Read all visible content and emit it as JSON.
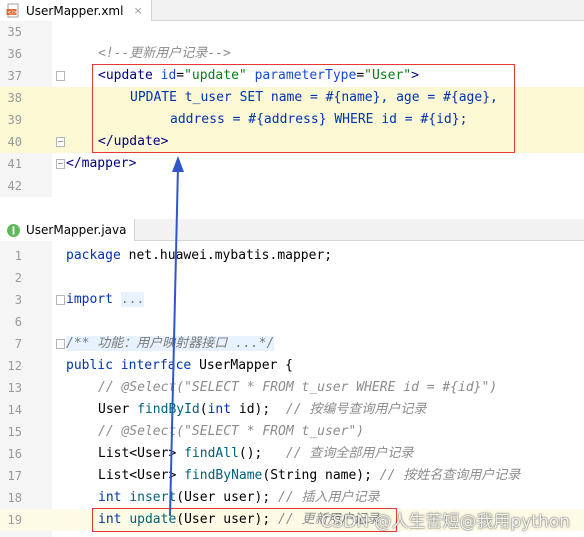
{
  "xml_tab": {
    "filename": "UserMapper.xml",
    "close": "×"
  },
  "java_tab": {
    "filename": "UserMapper.java"
  },
  "xml_lines": [
    {
      "num": "35"
    },
    {
      "num": "36",
      "comment": "<!--更新用户记录-->"
    },
    {
      "num": "37",
      "open_tag": "<update",
      "id_attr": "id",
      "id_val": "\"update\"",
      "param_attr": "parameterType",
      "param_val": "\"User\"",
      "close": ">"
    },
    {
      "num": "38",
      "sql": "UPDATE t_user SET name = #{name}, age = #{age},"
    },
    {
      "num": "39",
      "sql": "address = #{address} WHERE id = #{id};"
    },
    {
      "num": "40",
      "end_tag": "</update>"
    },
    {
      "num": "41",
      "end_tag": "</mapper>"
    },
    {
      "num": "42"
    }
  ],
  "java_lines": [
    {
      "num": "1",
      "kw": "package",
      "text": " net.huawei.mybatis.mapper;"
    },
    {
      "num": "2"
    },
    {
      "num": "3",
      "kw": "import",
      "folded": "..."
    },
    {
      "num": "6"
    },
    {
      "num": "7",
      "comment": "/** 功能：用户映射器接口 ...*/"
    },
    {
      "num": "12",
      "kw1": "public",
      "kw2": "interface",
      "text": " UserMapper {"
    },
    {
      "num": "13",
      "comment": "// @Select(\"SELECT * FROM t_user WHERE id = #{id}\")"
    },
    {
      "num": "14",
      "type": "User",
      "method": "findById",
      "args_kw": "int",
      "args": " id);",
      "comment": "// 按编号查询用户记录"
    },
    {
      "num": "15",
      "comment": "// @Select(\"SELECT * FROM t_user\")"
    },
    {
      "num": "16",
      "type": "List<User>",
      "method": "findAll",
      "args": "();",
      "comment": "// 查询全部用户记录"
    },
    {
      "num": "17",
      "type": "List<User>",
      "method": "findByName",
      "args": "(String name);",
      "comment": "// 按姓名查询用户记录"
    },
    {
      "num": "18",
      "kw": "int",
      "method": "insert",
      "args": "(User user);",
      "comment": "// 插入用户记录"
    },
    {
      "num": "19",
      "kw": "int",
      "method": "update",
      "args": "(User user);",
      "comment": "// 更新用户记录"
    }
  ],
  "watermark": "CSDN @人生苦短@我用python",
  "colors": {
    "highlight_box": "#e53935",
    "arrow": "#3057c8"
  }
}
